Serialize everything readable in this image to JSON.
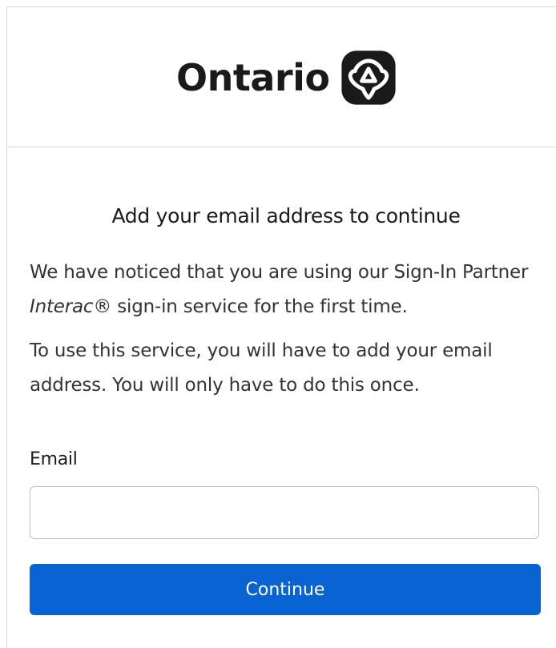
{
  "header": {
    "brand_name": "Ontario",
    "logo_icon": "ontario-trillium-icon"
  },
  "main": {
    "title": "Add your email address to continue",
    "paragraph1": {
      "before": "We have noticed that you are using our Sign-In Partner ",
      "emphasis": "Interac",
      "after": "® sign-in service for the first time."
    },
    "paragraph2": "To use this service, you will have to add your email address. You will only have to do this once.",
    "email_label": "Email",
    "email_value": "",
    "email_placeholder": "",
    "continue_label": "Continue"
  },
  "colors": {
    "primary_button": "#0a63d2",
    "border": "#d8d8d8",
    "text": "#1a1a1a"
  }
}
